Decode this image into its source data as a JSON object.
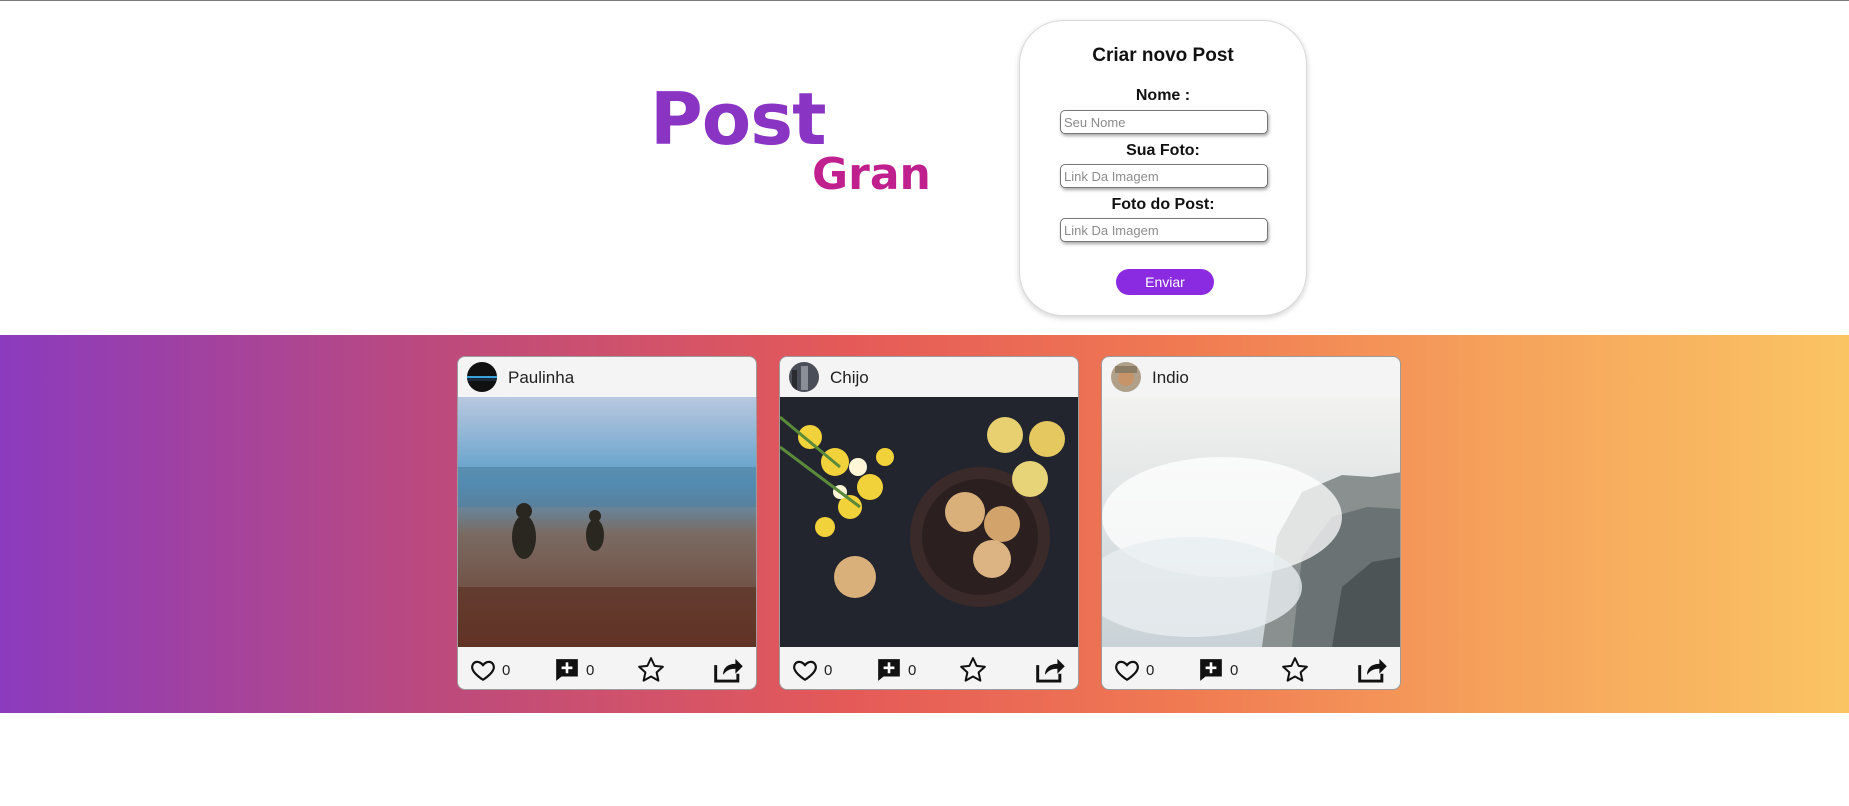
{
  "brand": {
    "line1": "Post",
    "line2": "Gran"
  },
  "form": {
    "title": "Criar novo Post",
    "fields": [
      {
        "label": "Nome :",
        "placeholder": "Seu Nome",
        "value": ""
      },
      {
        "label": "Sua Foto:",
        "placeholder": "Link Da Imagem",
        "value": ""
      },
      {
        "label": "Foto do Post:",
        "placeholder": "Link Da Imagem",
        "value": ""
      }
    ],
    "submit_label": "Enviar"
  },
  "colors": {
    "accent": "#8a2be2",
    "logo_post": "#8a34c4",
    "logo_gran": "#c0208e"
  },
  "posts": [
    {
      "author": "Paulinha",
      "photo": "misty field with two people",
      "likes": "0",
      "comments": "0"
    },
    {
      "author": "Chijo",
      "photo": "cookies, lemons and yellow flowers",
      "likes": "0",
      "comments": "0"
    },
    {
      "author": "Indio",
      "photo": "fog over rocky cliff",
      "likes": "0",
      "comments": "0"
    }
  ],
  "icons": {
    "like": "heart-icon",
    "comment": "add-comment-icon",
    "favorite": "star-icon",
    "share": "share-icon"
  }
}
